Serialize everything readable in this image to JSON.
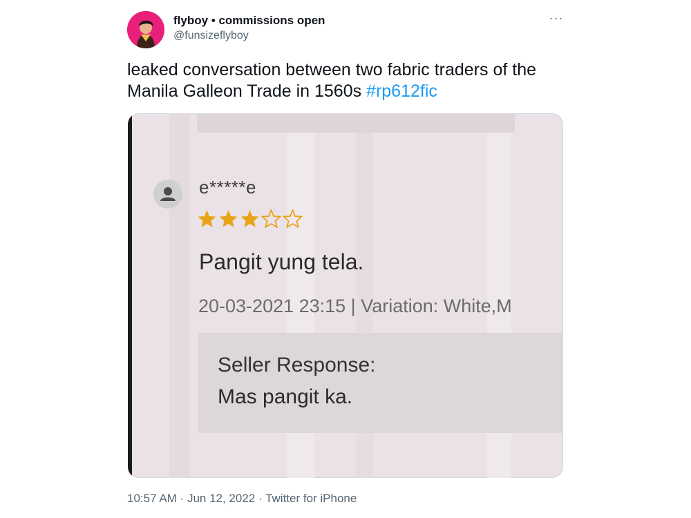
{
  "author": {
    "display_name": "flyboy • commissions open",
    "handle": "@funsizeflyboy"
  },
  "more_button": "···",
  "tweet": {
    "text": "leaked conversation between two fabric traders of the Manila Galleon Trade in 1560s ",
    "hashtag": "#rp612fic"
  },
  "media": {
    "reviewer": "e*****e",
    "rating": 3,
    "max_rating": 5,
    "review_text": "Pangit yung tela.",
    "review_meta": "20-03-2021 23:15 | Variation: White,M",
    "seller_response_label": "Seller Response:",
    "seller_response_text": "Mas pangit ka."
  },
  "footer": {
    "time": "10:57 AM",
    "separator": " · ",
    "date": "Jun 12, 2022",
    "source": "Twitter for iPhone"
  },
  "colors": {
    "hashtag": "#1d9bf0",
    "secondary_text": "#536471",
    "star_filled": "#e8a317",
    "avatar_bg": "#e8207a"
  }
}
